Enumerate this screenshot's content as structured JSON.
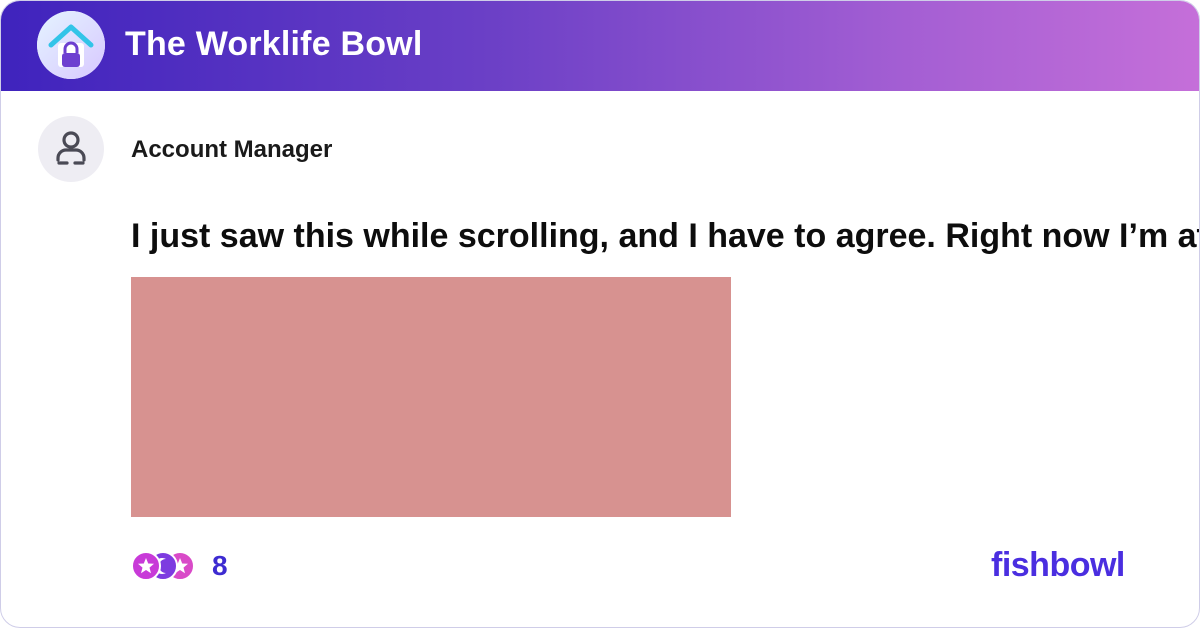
{
  "header": {
    "title": "The Worklife Bowl",
    "icon": "bowl-house-lock-icon",
    "gradient": [
      "#3f23bd",
      "#c56fd9"
    ]
  },
  "post": {
    "author": "Account Manager",
    "avatar_icon": "user-icon",
    "text": "I just saw this while scrolling, and I have to agree. Right now I’m at...",
    "image_color": "#d79290"
  },
  "reactions": {
    "icons": [
      "star-reaction-icon",
      "moon-reaction-icon",
      "sparkle-reaction-icon"
    ],
    "count": "8"
  },
  "brand": {
    "name": "fishbowl",
    "color": "#4a2ee0"
  }
}
